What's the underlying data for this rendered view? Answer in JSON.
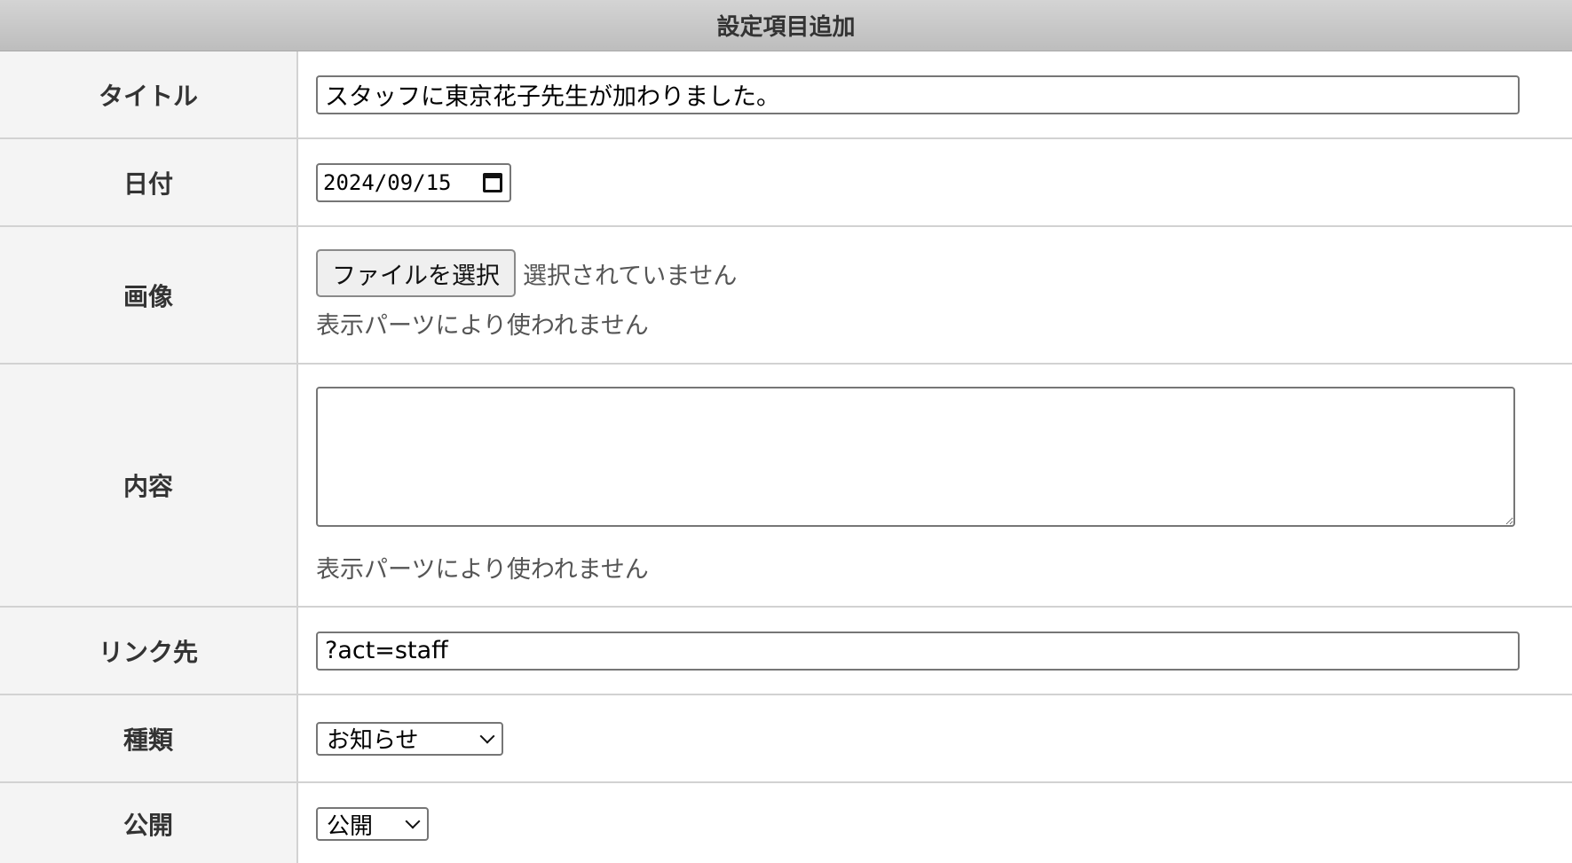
{
  "form": {
    "title": "設定項目追加",
    "fields": {
      "title": {
        "label": "タイトル",
        "value": "スタッフに東京花子先生が加わりました。"
      },
      "date": {
        "label": "日付",
        "value": "2024/09/15"
      },
      "image": {
        "label": "画像",
        "button_label": "ファイルを選択",
        "status": "選択されていません",
        "note": "表示パーツにより使われません"
      },
      "content": {
        "label": "内容",
        "value": "",
        "note": "表示パーツにより使われません"
      },
      "link": {
        "label": "リンク先",
        "value": "?act=staff"
      },
      "type": {
        "label": "種類",
        "selected": "お知らせ"
      },
      "publish": {
        "label": "公開",
        "selected": "公開"
      }
    }
  },
  "icons": {
    "calendar": "calendar-icon",
    "dropdown": "chevron-down-icon"
  }
}
